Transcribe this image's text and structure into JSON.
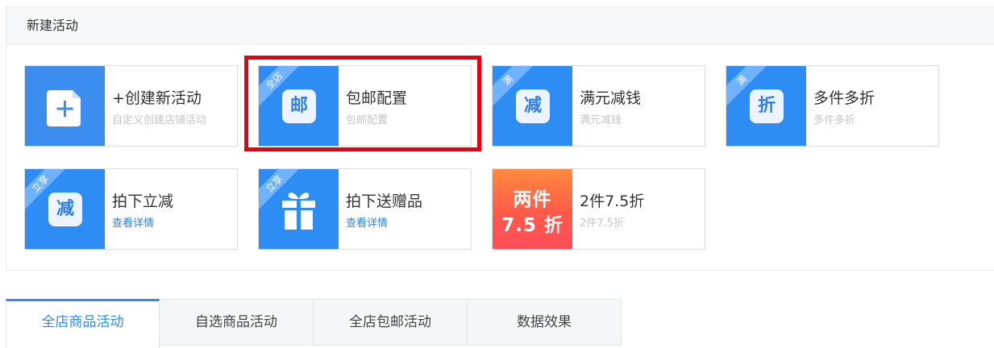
{
  "section": {
    "title": "新建活动"
  },
  "cards": [
    {
      "title": "+创建新活动",
      "subtitle": "自定义创建店铺活动"
    },
    {
      "title": "包邮配置",
      "subtitle": "包邮配置",
      "ribbon": "全店",
      "glyph": "邮"
    },
    {
      "title": "满元减钱",
      "subtitle": "满元减钱",
      "ribbon": "满",
      "glyph": "减"
    },
    {
      "title": "多件多折",
      "subtitle": "多件多折",
      "ribbon": "满",
      "glyph": "折"
    },
    {
      "title": "拍下立减",
      "subtitle": "查看详情",
      "ribbon": "立享",
      "glyph": "减"
    },
    {
      "title": "拍下送赠品",
      "subtitle": "查看详情",
      "ribbon": "立享"
    },
    {
      "title": "2件7.5折",
      "subtitle": "2件7.5折",
      "big_line1": "两件",
      "big_line2": "7.5 折"
    }
  ],
  "tabs": [
    {
      "label": "全店商品活动",
      "active": true
    },
    {
      "label": "自选商品活动"
    },
    {
      "label": "全店包邮活动"
    },
    {
      "label": "数据效果"
    }
  ],
  "colors": {
    "accent": "#2e8cf5",
    "highlight": "#e60012"
  }
}
